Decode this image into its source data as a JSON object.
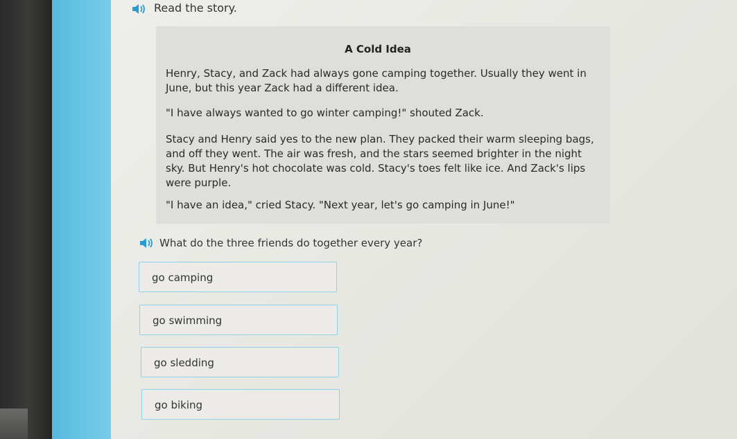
{
  "prompt": "Read the story.",
  "story": {
    "title": "A Cold Idea",
    "paragraphs": [
      "Henry, Stacy, and Zack had always gone camping together. Usually they went in June, but this year Zack had a different idea.",
      "\"I have always wanted to go winter camping!\" shouted Zack.",
      "Stacy and Henry said yes to the new plan. They packed their warm sleeping bags, and off they went. The air was fresh, and the stars seemed brighter in the night sky. But Henry's hot chocolate was cold. Stacy's toes felt like ice. And Zack's lips were purple.",
      "\"I have an idea,\" cried Stacy. \"Next year, let's go camping in June!\""
    ]
  },
  "question": "What do the three friends do together every year?",
  "choices": [
    "go camping",
    "go swimming",
    "go sledding",
    "go biking"
  ],
  "colors": {
    "accent": "#2a9bd1",
    "choice_border": "#8ed0e6",
    "side_strip": "#6cc6e6"
  },
  "icons": {
    "audio": "speaker-icon"
  }
}
